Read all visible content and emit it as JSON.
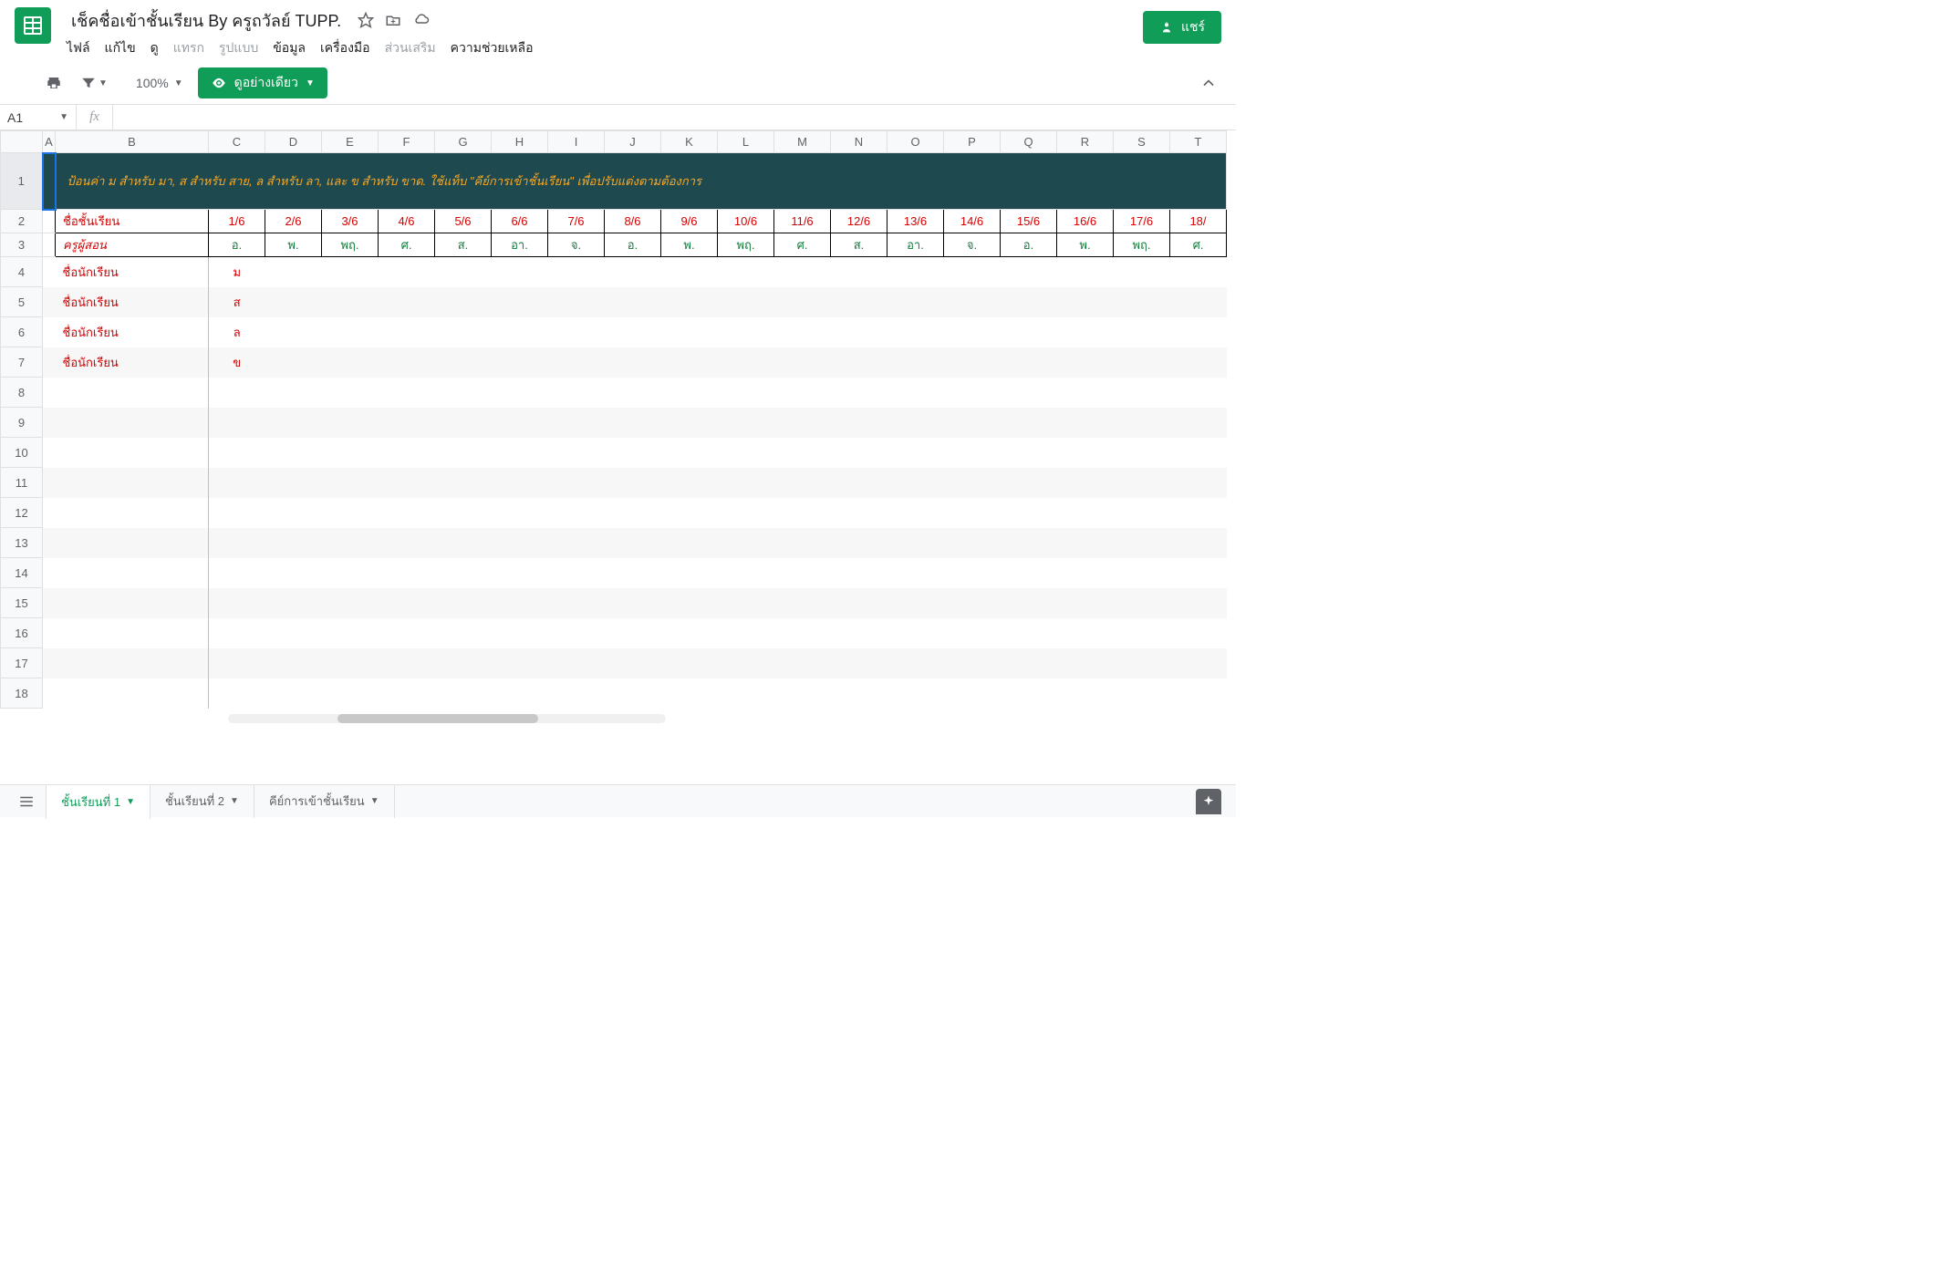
{
  "doc": {
    "title": "เช็คชื่อเข้าชั้นเรียน By ครูถวัลย์ TUPP."
  },
  "menu": {
    "file": "ไฟล์",
    "edit": "แก้ไข",
    "view": "ดู",
    "insert": "แทรก",
    "format": "รูปแบบ",
    "data": "ข้อมูล",
    "tools": "เครื่องมือ",
    "addons": "ส่วนเสริม",
    "help": "ความช่วยเหลือ"
  },
  "share": "แชร์",
  "toolbar": {
    "zoom": "100%",
    "view_only": "ดูอย่างเดียว"
  },
  "cell_ref": "A1",
  "banner": "ป้อนค่า ม สำหรับ มา, ส สำหรับ สาย, ล สำหรับ ลา, และ ข สำหรับ ขาด.  ใช้แท็บ \"คีย์การเข้าชั้นเรียน\" เพื่อปรับแต่งตามต้องการ",
  "labels": {
    "class": "ชื่อชั้นเรียน",
    "teacher": "ครูผู้สอน",
    "student": "ชื่อนักเรียน"
  },
  "columns": [
    "A",
    "B",
    "C",
    "D",
    "E",
    "F",
    "G",
    "H",
    "I",
    "J",
    "K",
    "L",
    "M",
    "N",
    "O",
    "P",
    "Q",
    "R",
    "S",
    "T"
  ],
  "dates": [
    "1/6",
    "2/6",
    "3/6",
    "4/6",
    "5/6",
    "6/6",
    "7/6",
    "8/6",
    "9/6",
    "10/6",
    "11/6",
    "12/6",
    "13/6",
    "14/6",
    "15/6",
    "16/6",
    "17/6",
    "18/"
  ],
  "days": [
    "อ.",
    "พ.",
    "พฤ.",
    "ศ.",
    "ส.",
    "อา.",
    "จ.",
    "อ.",
    "พ.",
    "พฤ.",
    "ศ.",
    "ส.",
    "อา.",
    "จ.",
    "อ.",
    "พ.",
    "พฤ.",
    "ศ."
  ],
  "students": [
    {
      "name": "ชื่อนักเรียน",
      "val": "ม"
    },
    {
      "name": "ชื่อนักเรียน",
      "val": "ส"
    },
    {
      "name": "ชื่อนักเรียน",
      "val": "ล"
    },
    {
      "name": "ชื่อนักเรียน",
      "val": "ข"
    }
  ],
  "tabs": {
    "t1": "ชั้นเรียนที่ 1",
    "t2": "ชั้นเรียนที่ 2",
    "t3": "คีย์การเข้าชั้นเรียน"
  }
}
